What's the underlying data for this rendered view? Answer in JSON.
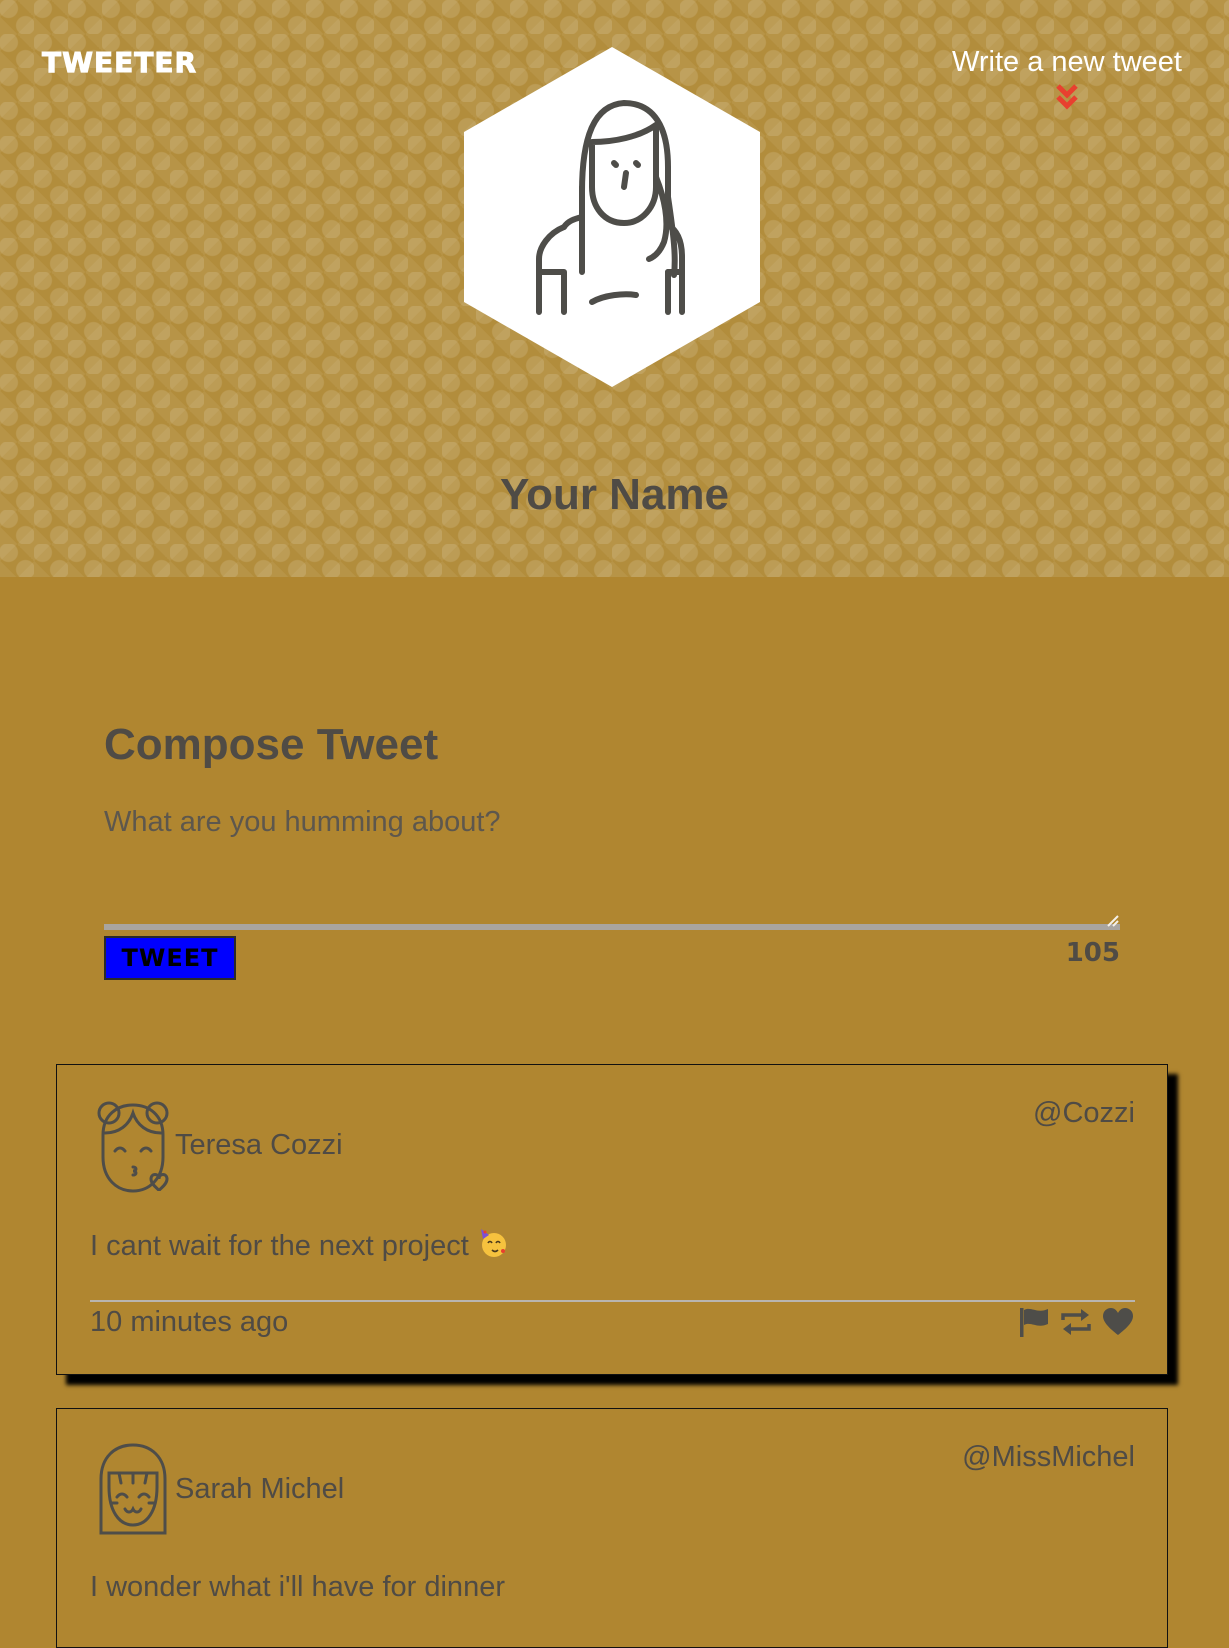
{
  "nav": {
    "logo": "TWEETER",
    "write_link": "Write a new tweet",
    "chevron_icon": "double-chevron-down-icon",
    "chevron_color": "#e8402f"
  },
  "profile": {
    "name": "Your Name",
    "avatar_icon": "user-avatar-icon"
  },
  "compose": {
    "title": "Compose Tweet",
    "placeholder": "What are you humming about?",
    "button_label": "TWEET",
    "button_color": "#0000ff",
    "counter": "105"
  },
  "tweets": [
    {
      "name": "Teresa Cozzi",
      "handle": "@Cozzi",
      "text": "I cant wait for the next project",
      "emoji": "partying-face-emoji",
      "time": "10 minutes ago",
      "avatar_icon": "girl-kiss-avatar-icon"
    },
    {
      "name": "Sarah Michel",
      "handle": "@MissMichel",
      "text": "I wonder what i'll have for dinner",
      "avatar_icon": "girl-smile-avatar-icon"
    }
  ],
  "colors": {
    "page_background": "#b08630",
    "text": "#4f4b45"
  }
}
